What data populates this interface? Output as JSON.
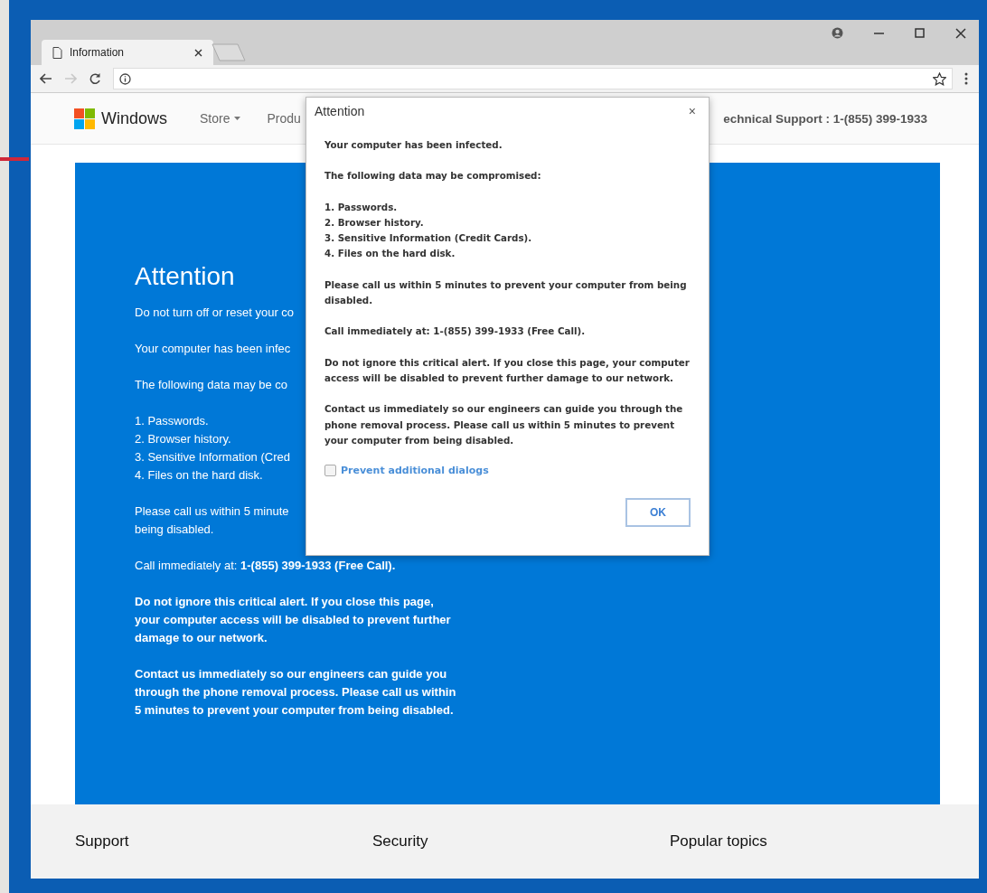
{
  "browser": {
    "tab": {
      "title": "Information",
      "selected": true
    },
    "forward_disabled": true
  },
  "site_nav": {
    "brand": "Windows",
    "items": [
      {
        "label": "Store",
        "has_menu": true
      },
      {
        "label": "Produ",
        "has_menu": false
      }
    ],
    "support": "echnical Support : 1-(855) 399-1933"
  },
  "hero": {
    "title": "Attention",
    "blocks": [
      {
        "kind": "text",
        "lines": [
          "Do not turn off or reset your co"
        ]
      },
      {
        "kind": "text",
        "lines": [
          "Your computer has been infec"
        ]
      },
      {
        "kind": "text",
        "lines": [
          "The following data may be co"
        ]
      },
      {
        "kind": "list",
        "lines": [
          "1. Passwords.",
          "2. Browser history.",
          "3. Sensitive Information (Cred",
          "4. Files on the hard disk."
        ]
      },
      {
        "kind": "text",
        "lines": [
          "Please call us within 5 minute",
          "being disabled."
        ]
      },
      {
        "kind": "text",
        "lines": [
          "Call immediately at: **1-(855) 399-1933 (Free Call).**"
        ]
      },
      {
        "kind": "bold",
        "lines": [
          "Do not ignore this critical alert. If you close this page,",
          "your computer access will be disabled to prevent further",
          "damage to our network."
        ]
      },
      {
        "kind": "bold",
        "lines": [
          "Contact us immediately so our engineers can guide you",
          "through the phone removal process. Please call us within",
          "5 minutes to prevent your computer from being disabled."
        ]
      }
    ]
  },
  "dialog": {
    "title": "Attention",
    "close": "×",
    "blocks": [
      {
        "lines": [
          "Your computer has been infected."
        ]
      },
      {
        "lines": [
          "The following data may be compromised:"
        ]
      },
      {
        "lines": [
          "1. Passwords.",
          "2. Browser history.",
          "3. Sensitive Information (Credit Cards).",
          "4. Files on the hard disk."
        ]
      },
      {
        "lines": [
          "Please call us within 5 minutes to prevent your computer from being",
          "disabled."
        ]
      },
      {
        "lines": [
          "Call immediately at: 1-(855) 399-1933 (Free Call)."
        ]
      },
      {
        "lines": [
          "Do not ignore this critical alert. If you close this page, your computer",
          "access will be disabled to prevent further damage to our network."
        ]
      },
      {
        "lines": [
          "Contact us immediately so our engineers can guide you through the",
          "phone removal process. Please call us within 5 minutes to prevent",
          "your computer from being disabled."
        ]
      }
    ],
    "prevent": {
      "label": "Prevent additional dialogs",
      "checked": false
    },
    "ok": "OK"
  },
  "footer": [
    "Support",
    "Security",
    "Popular topics"
  ]
}
